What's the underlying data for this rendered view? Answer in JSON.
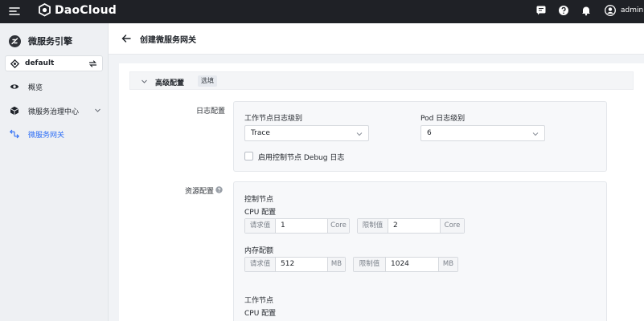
{
  "topbar": {
    "brand": "DaoCloud",
    "user": "admin"
  },
  "sidebar": {
    "title": "微服务引擎",
    "workspace": "default",
    "items": [
      {
        "label": "概览"
      },
      {
        "label": "微服务治理中心"
      },
      {
        "label": "微服务网关"
      }
    ]
  },
  "page": {
    "title": "创建微服务网关"
  },
  "section": {
    "title": "高级配置",
    "tag": "选填"
  },
  "log": {
    "label": "日志配置",
    "worker_label": "工作节点日志级别",
    "worker_value": "Trace",
    "pod_label": "Pod 日志级别",
    "pod_value": "6",
    "debug_label": "启用控制节点 Debug 日志"
  },
  "resource": {
    "label": "资源配置",
    "control_title": "控制节点",
    "worker_title": "工作节点",
    "cpu_label": "CPU 配置",
    "mem_label": "内存配额",
    "request_label": "请求值",
    "limit_label": "限制值",
    "control_cpu": {
      "request": "1",
      "limit": "2",
      "unit": "Core"
    },
    "control_mem": {
      "request": "512",
      "limit": "1024",
      "unit": "MB"
    }
  },
  "colors": {
    "accent": "#2a6cf6",
    "topbar": "#1f2126"
  }
}
